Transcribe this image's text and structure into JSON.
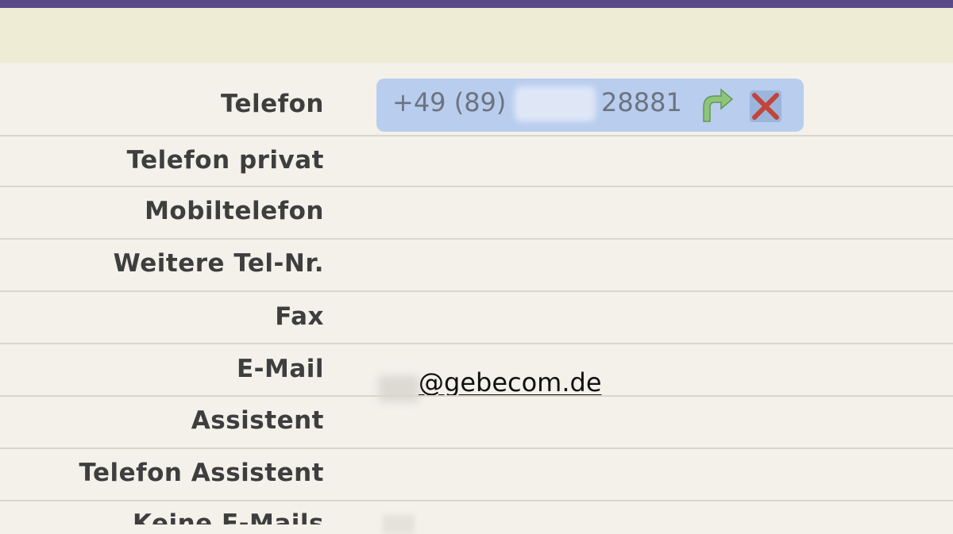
{
  "fields": [
    {
      "label": "Telefon"
    },
    {
      "label": "Telefon privat"
    },
    {
      "label": "Mobiltelefon"
    },
    {
      "label": "Weitere Tel-Nr."
    },
    {
      "label": "Fax"
    },
    {
      "label": "E-Mail"
    },
    {
      "label": "Assistent"
    },
    {
      "label": "Telefon Assistent"
    },
    {
      "label": "Keine E-Mails"
    }
  ],
  "phone": {
    "prefix": "+49 (89)",
    "suffix": "28881",
    "call_icon": "call-icon",
    "hangup_icon": "hangup-icon"
  },
  "email": {
    "domain_part": "@gebecom.de"
  },
  "colors": {
    "topbar": "#5a4a8a",
    "toolbar_band": "#efecd6",
    "form_bg": "#f3f1ea",
    "phone_pill": "#b9cdee"
  }
}
